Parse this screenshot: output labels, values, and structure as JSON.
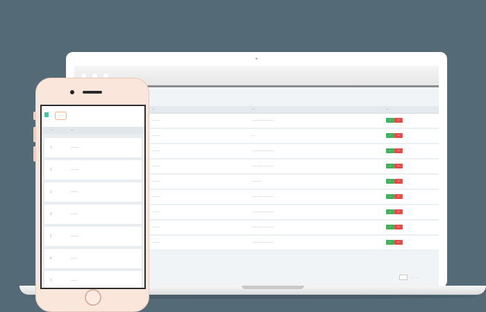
{
  "colors": {
    "background": "#546b77",
    "accept": "#43b05c",
    "reject": "#e54b4b",
    "badge_border": "#f2b38d",
    "logo": "#42c6a3"
  },
  "laptop": {
    "table": {
      "headers": [
        "···",
        "···",
        "···"
      ],
      "rows": [
        {
          "name": "·········",
          "desc": "·························",
          "accept": "✓",
          "reject": "✕"
        },
        {
          "name": "·········",
          "desc": "···",
          "accept": "✓",
          "reject": "✕"
        },
        {
          "name": "·········",
          "desc": "·························",
          "accept": "✓",
          "reject": "✕"
        },
        {
          "name": "·········",
          "desc": "·························",
          "accept": "✓",
          "reject": "✕"
        },
        {
          "name": "·········",
          "desc": "··········",
          "accept": "✓",
          "reject": "✕"
        },
        {
          "name": "·········",
          "desc": "·························",
          "accept": "✓",
          "reject": "✕"
        },
        {
          "name": "·········",
          "desc": "·························",
          "accept": "✓",
          "reject": "✕"
        },
        {
          "name": "·········",
          "desc": "·························",
          "accept": "✓",
          "reject": "✕"
        },
        {
          "name": "·········",
          "desc": "·························",
          "accept": "✓",
          "reject": "✕"
        }
      ]
    },
    "pagination": {
      "text": "·· ···"
    }
  },
  "phone": {
    "badge": "·······",
    "headers": [
      "···",
      "···"
    ],
    "rows": [
      {
        "num": "1",
        "name": "·········"
      },
      {
        "num": "2",
        "name": "·········"
      },
      {
        "num": "3",
        "name": "········"
      },
      {
        "num": "4",
        "name": "········"
      },
      {
        "num": "5",
        "name": "·········"
      },
      {
        "num": "6",
        "name": "·······"
      },
      {
        "num": "7",
        "name": "·······"
      }
    ]
  }
}
